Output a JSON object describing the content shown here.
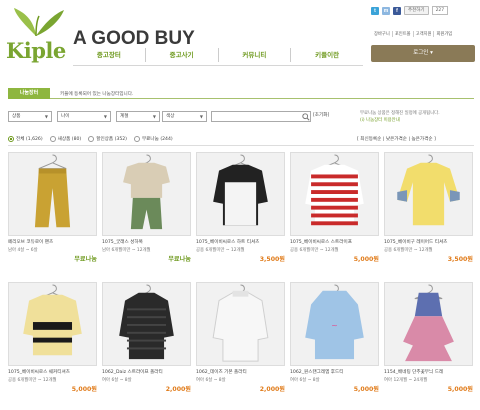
{
  "header": {
    "logo_text": "Kiple",
    "brand": "A GOOD BUY",
    "nav": [
      "중고장터",
      "중고사기",
      "커뮤니티",
      "키플이란"
    ],
    "social": {
      "recommend": "추천하기",
      "count": "227"
    },
    "toplinks": [
      "장바구니",
      "포인트몰",
      "고객지원",
      "회원가입"
    ],
    "login_label": "로그인"
  },
  "tabs": {
    "active": "나눔장터",
    "description": "키플에 등록되어 있는 나눔장터입니다."
  },
  "filters": {
    "selects": [
      "상품",
      "나이",
      "계절",
      "색상"
    ],
    "search_placeholder": "",
    "reset_label": "[초기화]",
    "note_line1": "무료나눔 상품은 정해진 일정에 공개됩니다.",
    "note_line2": "(i) 나눔장터 이용안내",
    "radios": [
      {
        "label": "전체 (1,626)",
        "selected": true
      },
      {
        "label": "새상품 (80)",
        "selected": false
      },
      {
        "label": "할인상품 (352)",
        "selected": false
      },
      {
        "label": "무료나눔 (244)",
        "selected": false
      }
    ],
    "sorts": "[ 최신등록순 | 낮은가격순 | 높은가격순 ]"
  },
  "products": [
    {
      "title": "페리오브 코듀로이 팬츠",
      "meta": "남아 4살 ~ 6살",
      "price": "무료나눔",
      "free": true,
      "kind": "pants-mustard",
      "colors": [
        "#c9a233",
        "#b7912a"
      ]
    },
    {
      "title": "1075_굿래스 성하복",
      "meta": "남아 6개월미만 ~ 12개월",
      "price": "무료나눔",
      "free": true,
      "kind": "set-beige-green",
      "colors": [
        "#d9cdb5",
        "#6b8a5a"
      ]
    },
    {
      "title": "1075_베이비씨로스 하트 티셔츠",
      "meta": "공용 6개월미만 ~ 12개월",
      "price": "3,500원",
      "free": false,
      "kind": "sweater-bw",
      "colors": [
        "#f4f4f4",
        "#222222"
      ]
    },
    {
      "title": "1075_베이비씨로스 스트라이프",
      "meta": "공용 6개월미만 ~ 12개월",
      "price": "5,000원",
      "free": false,
      "kind": "stripe-red",
      "colors": [
        "#c92a2a",
        "#ffffff"
      ]
    },
    {
      "title": "1075_베이비구 레이어드 티셔츠",
      "meta": "공용 6개월미만 ~ 12개월",
      "price": "3,500원",
      "free": false,
      "kind": "tee-yellow",
      "colors": [
        "#f2dd6c",
        "#7a96b8"
      ]
    },
    {
      "title": "1075_베이비씨로스 쉐커티셔츠",
      "meta": "공용 6개월미만 ~ 12개월",
      "price": "5,000원",
      "free": false,
      "kind": "stripe-yellow",
      "colors": [
        "#f0e09a",
        "#1a1a1a"
      ]
    },
    {
      "title": "1062_Daiz 스트라이프 폴라티",
      "meta": "여아 6살 ~ 8살",
      "price": "2,000원",
      "free": false,
      "kind": "polo-black",
      "colors": [
        "#2a2a2a",
        "#444444"
      ]
    },
    {
      "title": "1062_데이즈 기본 폴라티",
      "meta": "여아 6살 ~ 8살",
      "price": "2,000원",
      "free": false,
      "kind": "polo-white",
      "colors": [
        "#f7f7f7",
        "#e3e3e3"
      ]
    },
    {
      "title": "1062_원스탠그레엠 후드티",
      "meta": "여아 6살 ~ 8살",
      "price": "5,000원",
      "free": false,
      "kind": "hood-blue",
      "colors": [
        "#9fc4e6",
        "#e24d8e"
      ]
    },
    {
      "title": "1154_배네팅 단추꽃무늬 드레",
      "meta": "여아 12개월 ~ 24개월",
      "price": "5,000원",
      "free": false,
      "kind": "dress-floral",
      "colors": [
        "#5d6fb0",
        "#d98aa8"
      ]
    }
  ]
}
